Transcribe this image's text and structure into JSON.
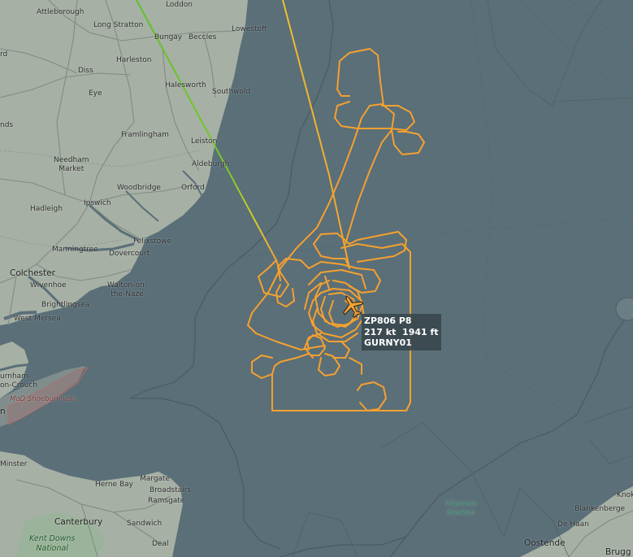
{
  "aircraft": {
    "registration_type": "ZP806 P8",
    "speed": "217 kt",
    "altitude": "1941 ft",
    "callsign": "GURNY01"
  },
  "places": {
    "attleborough": "Attleborough",
    "loddon": "Loddon",
    "long_stratton": "Long Stratton",
    "bungay": "Bungay",
    "beccles": "Beccles",
    "lowestoft": "Lowestoft",
    "rd": "rd",
    "harleston": "Harleston",
    "diss": "Diss",
    "halesworth": "Halesworth",
    "eye": "Eye",
    "southwold": "Southwold",
    "nds": "nds",
    "framlingham": "Framlingham",
    "leiston": "Leiston",
    "needham_market": "Needham\nMarket",
    "aldeburgh": "Aldeburgh",
    "woodbridge": "Woodbridge",
    "orford": "Orford",
    "ipswich": "Ipswich",
    "hadleigh": "Hadleigh",
    "felixstowe": "Felixstowe",
    "manningtree": "Manningtree",
    "dovercourt": "Dovercourt",
    "colchester": "Colchester",
    "wivenhoe": "Wivenhoe",
    "walton": "Walton-on-\nthe-Naze",
    "brightlingsea": "Brightlingsea",
    "west_mersea": "West Mersea",
    "burnham": "urnham-\non-Crouch",
    "mod_shoeburyness": "MoD Shoeburyness",
    "n": "n",
    "minster": "Minster",
    "herne_bay": "Herne Bay",
    "margate": "Margate",
    "broadstairs": "Broadstairs",
    "ramsgate": "Ramsgate",
    "canterbury": "Canterbury",
    "sandwich": "Sandwich",
    "kent_downs": "Kent Downs\nNational",
    "deal": "Deal",
    "vlaamse_banken": "Vlaamse\nBanken",
    "blankenberge": "Blankenberge",
    "knokke": "Knok",
    "de_haan": "De Haan",
    "oostende": "Oostende",
    "brugge": "Brugg"
  },
  "colors": {
    "sea": "#5a6f78",
    "land": "#a4aea2",
    "track_orange": "#f5a030",
    "track_yellow": "#f0c030",
    "track_green": "#5ec02a",
    "label_bg": "#3a484f"
  }
}
